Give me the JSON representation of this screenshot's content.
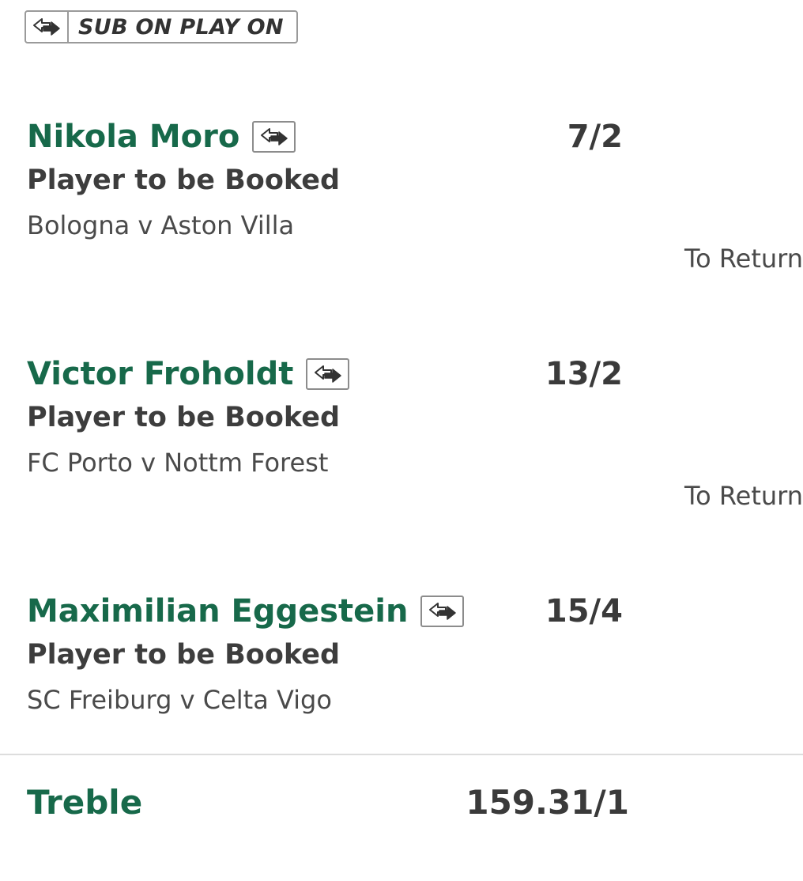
{
  "header": {
    "sub_badge": {
      "icon": "substitution-arrows-icon",
      "label": "SUB ON PLAY ON"
    }
  },
  "selections": [
    {
      "player": "Nikola Moro",
      "sub_icon": "substitution-arrows-icon",
      "odds": "7/2",
      "market": "Player to be Booked",
      "event": "Bologna v Aston Villa",
      "return_label": "To Return"
    },
    {
      "player": "Victor Froholdt",
      "sub_icon": "substitution-arrows-icon",
      "odds": "13/2",
      "market": "Player to be Booked",
      "event": "FC Porto v Nottm Forest",
      "return_label": "To Return"
    },
    {
      "player": "Maximilian Eggestein",
      "sub_icon": "substitution-arrows-icon",
      "odds": "15/4",
      "market": "Player to be Booked",
      "event": "SC Freiburg v Celta Vigo"
    }
  ],
  "multiple": {
    "label": "Treble",
    "odds": "159.31/1"
  },
  "colors": {
    "accent_green": "#17694a",
    "text_dark": "#3a3a3a",
    "border_grey": "#9a9a9a"
  }
}
